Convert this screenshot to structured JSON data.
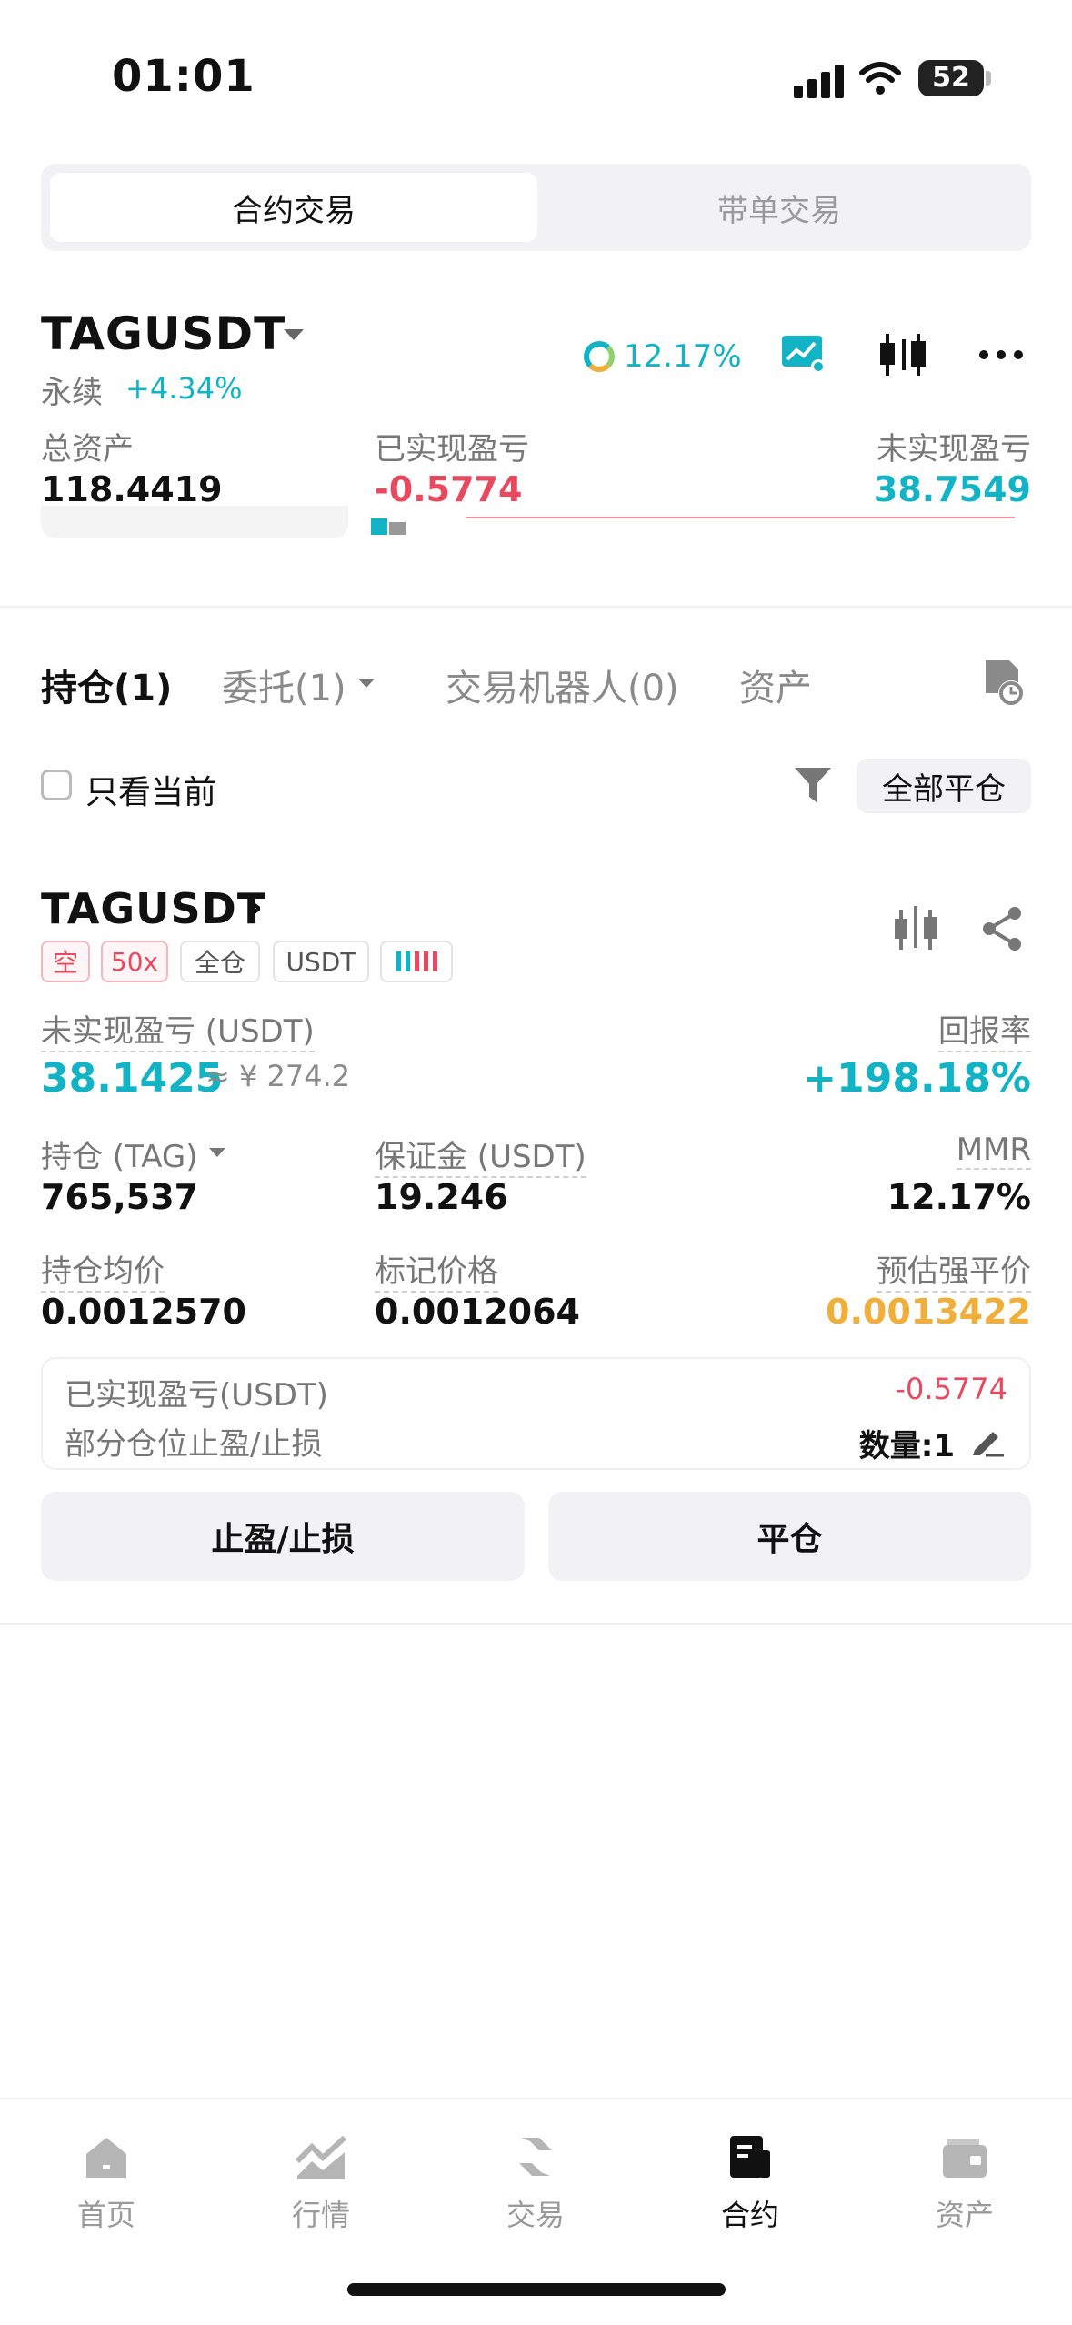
{
  "status_bar": {
    "time": "01:01",
    "battery": "52"
  },
  "segment": {
    "active": "合约交易",
    "inactive": "带单交易"
  },
  "header": {
    "symbol": "TAGUSDT",
    "perpetual": "永续",
    "change": "+4.34%",
    "mmr_percent": "12.17%"
  },
  "summary": {
    "total_assets_label": "总资产",
    "total_assets": "118.4419",
    "realized_pnl_label": "已实现盈亏",
    "realized_pnl": "-0.5774",
    "unrealized_pnl_label": "未实现盈亏",
    "unrealized_pnl": "38.7549"
  },
  "tabs": [
    {
      "label": "持仓(1)",
      "active": true
    },
    {
      "label": "委托(1)",
      "active": false
    },
    {
      "label": "交易机器人(0)",
      "active": false
    },
    {
      "label": "资产",
      "active": false
    }
  ],
  "filter": {
    "only_current": "只看当前",
    "close_all": "全部平仓"
  },
  "position": {
    "symbol": "TAGUSDT",
    "tags": [
      "空",
      "50x",
      "全仓",
      "USDT"
    ],
    "unrealized_label": "未实现盈亏 (USDT)",
    "unrealized_value": "38.1425",
    "unrealized_cny": "≈ ¥ 274.2",
    "roe_label": "回报率",
    "roe_value": "+198.18%",
    "size_label": "持仓 (TAG)",
    "size_value": "765,537",
    "margin_label": "保证金 (USDT)",
    "margin_value": "19.246",
    "mmr_label": "MMR",
    "mmr_value": "12.17%",
    "entry_label": "持仓均价",
    "entry_value": "0.0012570",
    "mark_label": "标记价格",
    "mark_value": "0.0012064",
    "liq_label": "预估强平价",
    "liq_value": "0.0013422",
    "realized_label": "已实现盈亏(USDT)",
    "realized_value": "-0.5774",
    "partial_tpsl_label": "部分仓位止盈/止损",
    "quantity_label": "数量:1",
    "tpsl_button": "止盈/止损",
    "close_button": "平仓"
  },
  "nav": [
    {
      "label": "首页",
      "icon": "home-icon",
      "active": false
    },
    {
      "label": "行情",
      "icon": "market-chart-icon",
      "active": false
    },
    {
      "label": "交易",
      "icon": "trade-icon",
      "active": false
    },
    {
      "label": "合约",
      "icon": "futures-icon",
      "active": true
    },
    {
      "label": "资产",
      "icon": "wallet-icon",
      "active": false
    }
  ],
  "colors": {
    "up": "#12b3c4",
    "down": "#e8495f",
    "warning": "#f0ae3a",
    "text": "#111111",
    "muted": "#8a8a8a"
  }
}
